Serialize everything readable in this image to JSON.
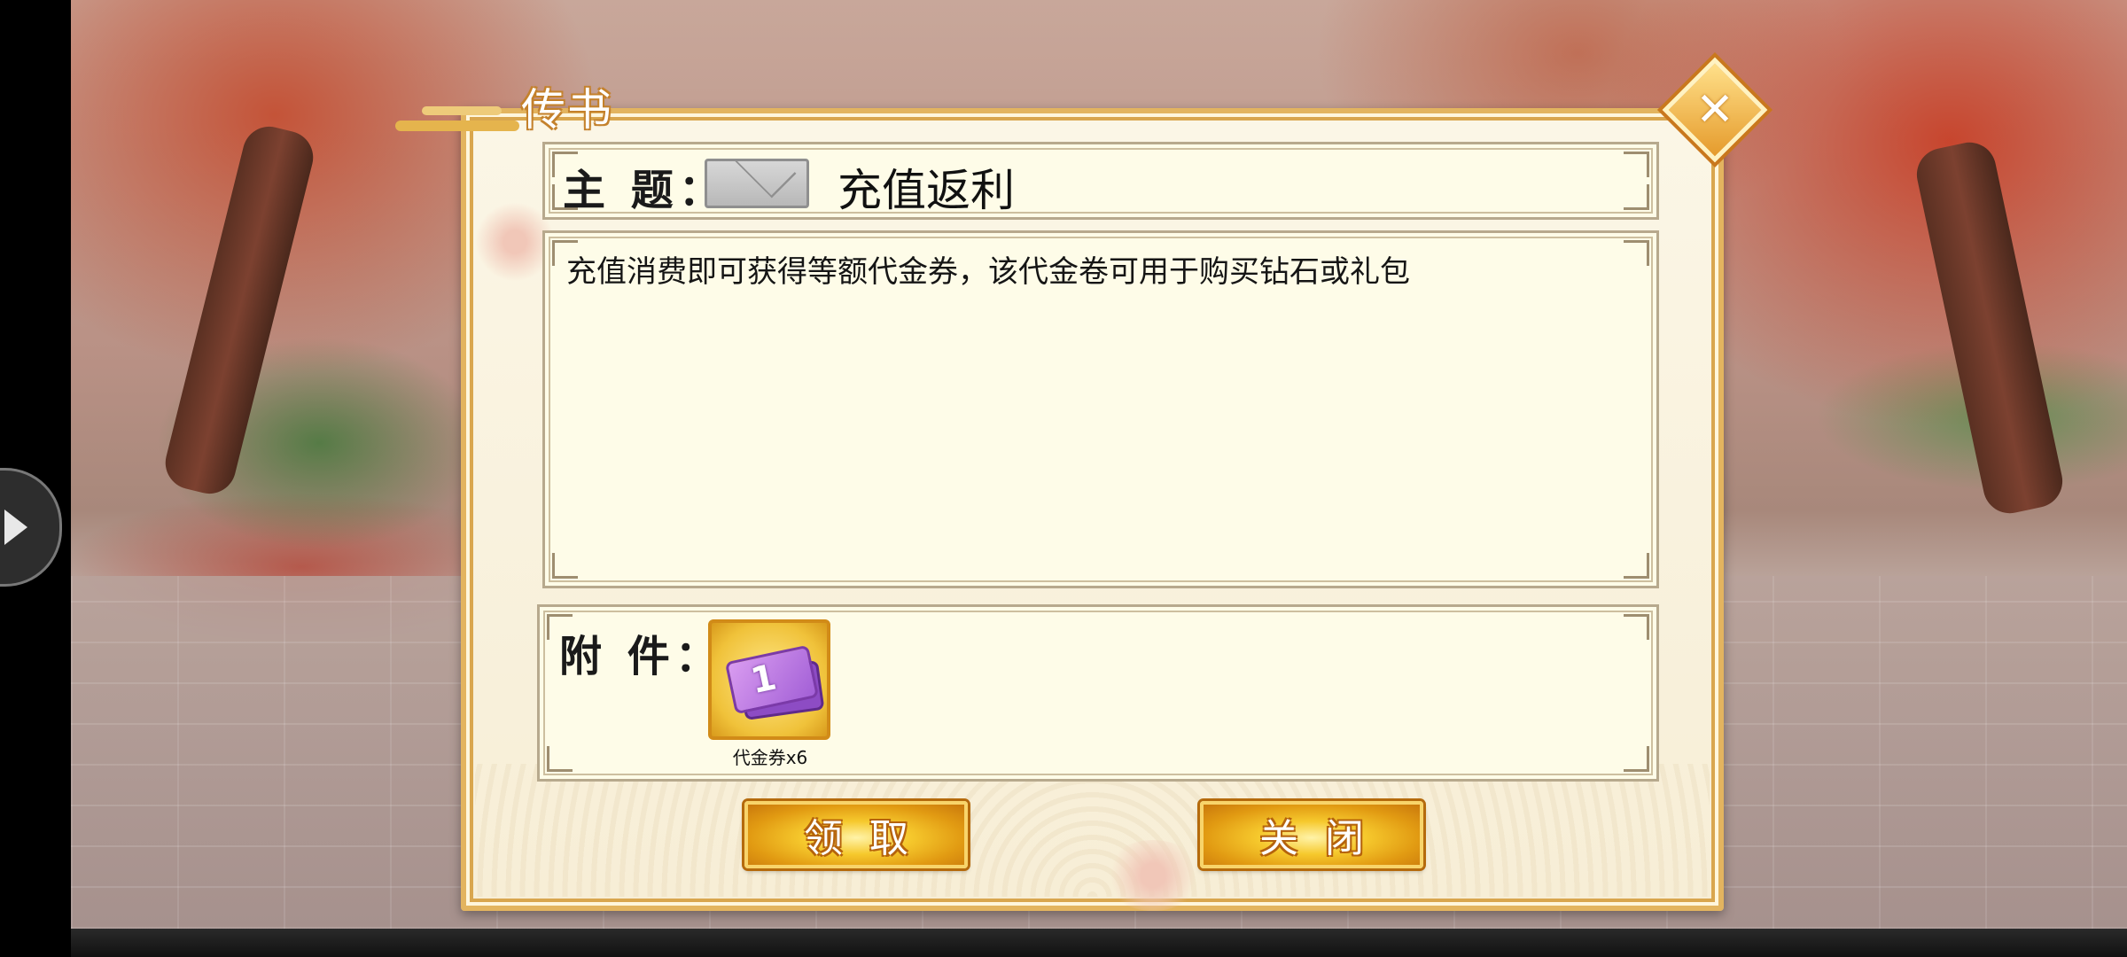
{
  "dialog": {
    "title": "传书",
    "close_glyph": "✕",
    "subject_label": "主 题：",
    "subject": "充值返利",
    "body": "充值消费即可获得等额代金券，该代金卷可用于购买钻石或礼包",
    "attachment_label": "附 件：",
    "attachments": [
      {
        "icon": "voucher-ticket-icon",
        "number": "1",
        "caption": "代金券x6"
      }
    ],
    "claim_button": "领取",
    "close_button": "关闭"
  },
  "colors": {
    "frame_gold": "#e3b45f",
    "panel_bg": "#fefce8",
    "button_gold": "#f6c92d",
    "voucher_purple": "#a25fd6"
  },
  "icons": [
    "mail-icon",
    "close-icon",
    "voucher-ticket-icon",
    "side-expand-icon"
  ]
}
